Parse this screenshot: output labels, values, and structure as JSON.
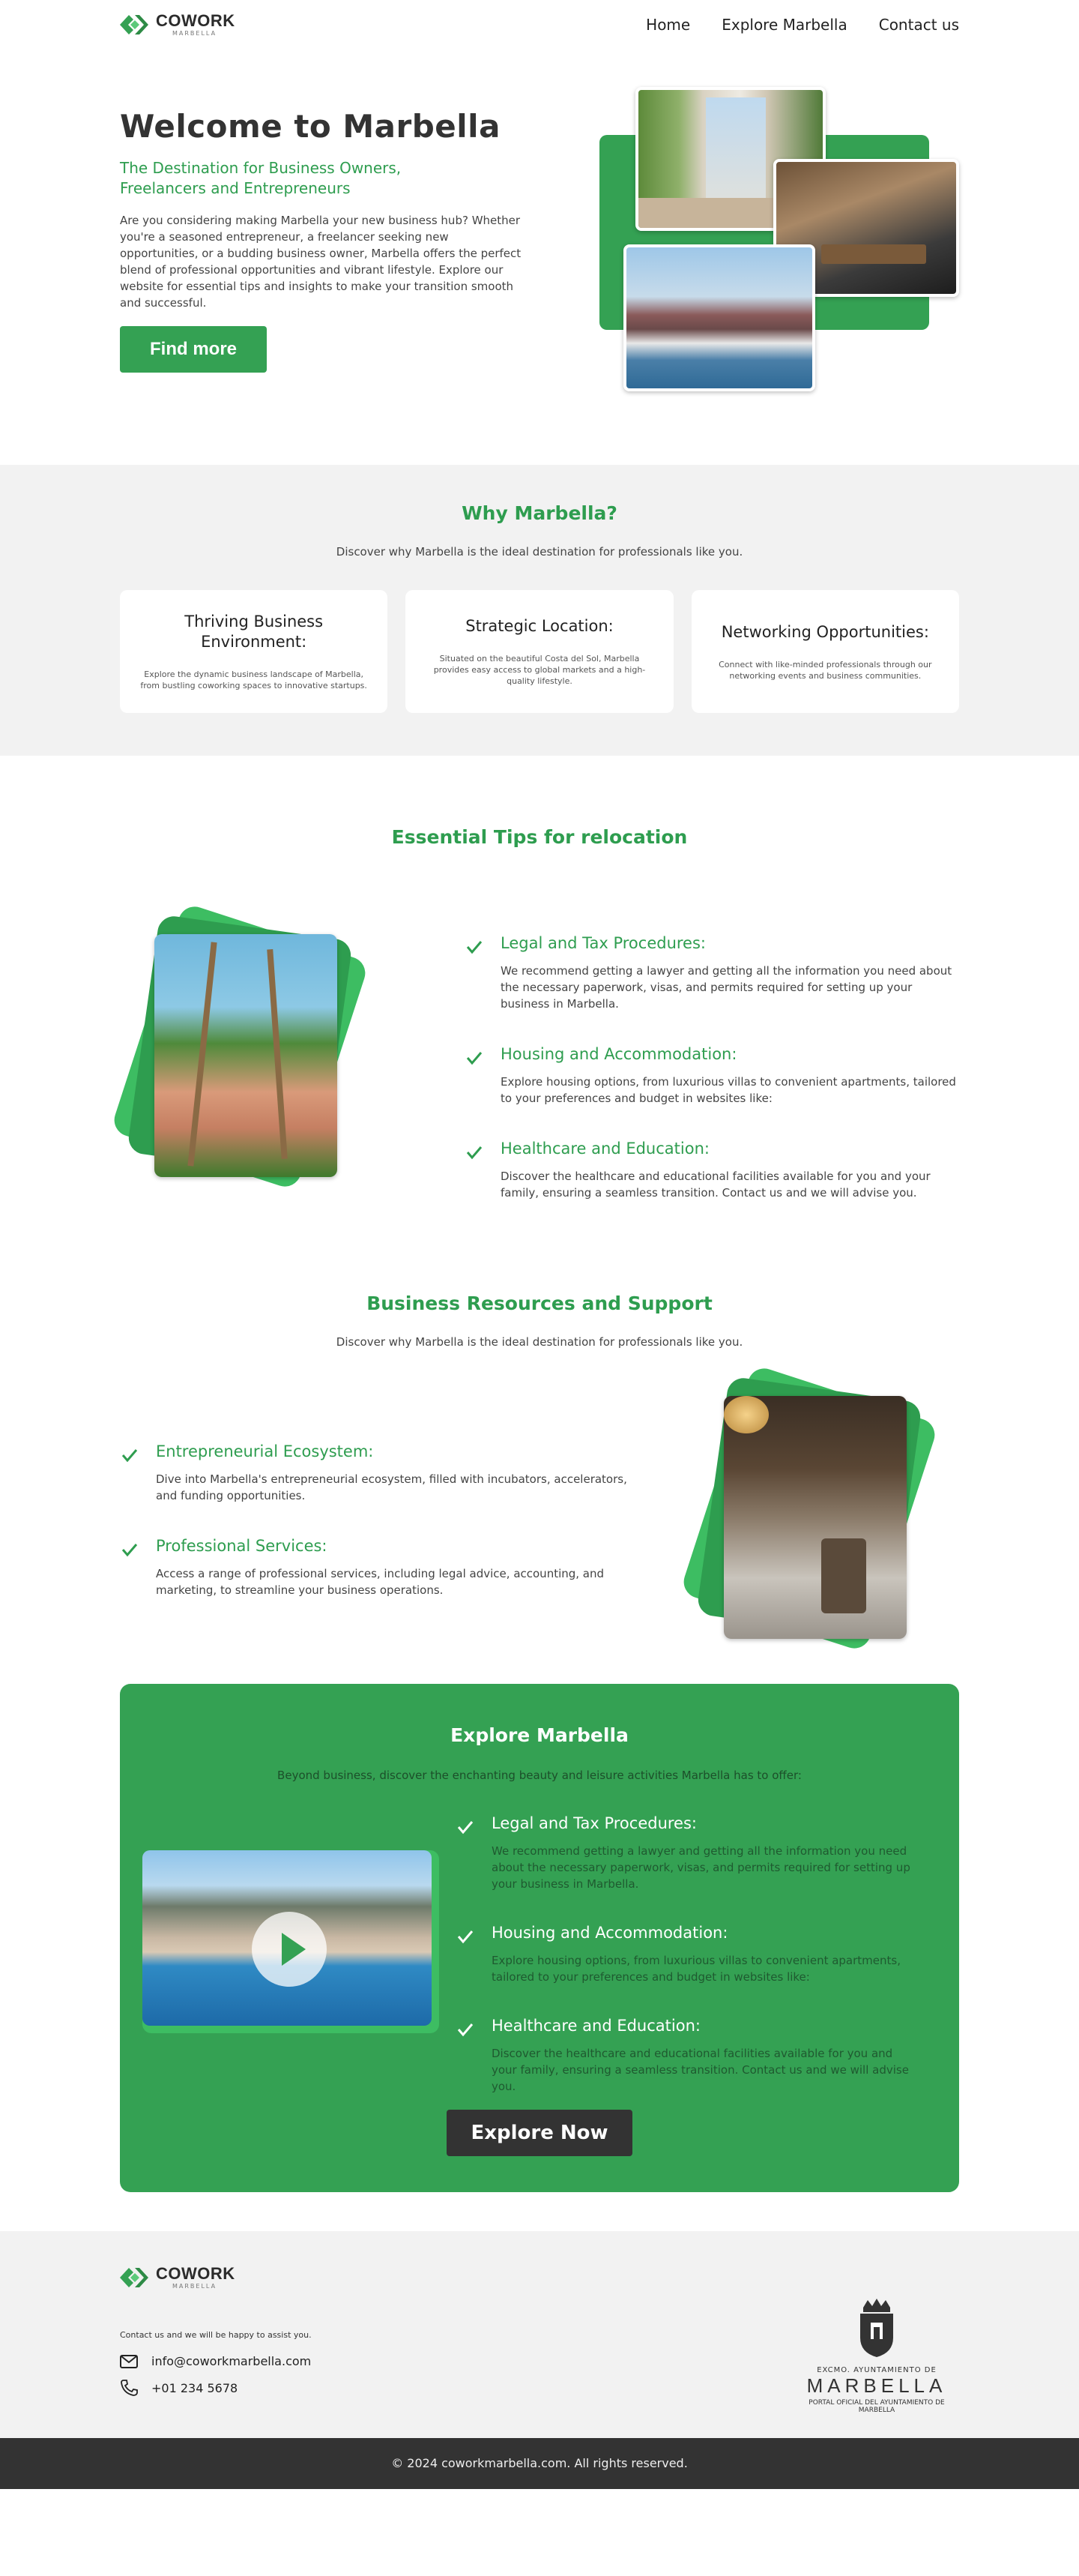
{
  "header": {
    "logo_main": "COWORK",
    "logo_sub": "MARBELLA",
    "nav": [
      "Home",
      "Explore Marbella",
      "Contact us"
    ]
  },
  "hero": {
    "title": "Welcome to Marbella",
    "subtitle": "The Destination for Business Owners, Freelancers and Entrepreneurs",
    "body": "Are you considering making Marbella your new business hub? Whether you're a seasoned entrepreneur, a freelancer seeking new opportunities, or a budding business owner, Marbella offers the perfect blend of professional opportunities and vibrant lifestyle. Explore our website for essential tips and insights to make your transition smooth and successful.",
    "button": "Find more"
  },
  "why": {
    "title": "Why Marbella?",
    "subtitle": "Discover why Marbella is the ideal destination for professionals like you.",
    "cards": [
      {
        "title": "Thriving Business Environment:",
        "text": "Explore the dynamic business landscape of Marbella, from bustling coworking spaces to innovative startups."
      },
      {
        "title": "Strategic Location:",
        "text": "Situated on the beautiful Costa del Sol, Marbella provides easy access to global markets and a high-quality lifestyle."
      },
      {
        "title": "Networking Opportunities:",
        "text": "Connect with like-minded professionals through our networking events and business communities."
      }
    ]
  },
  "tips": {
    "title": "Essential Tips for relocation",
    "items": [
      {
        "title": "Legal and Tax Procedures:",
        "text": "We recommend getting a lawyer and getting all the information you need about the necessary paperwork, visas, and permits required for setting up your business in Marbella."
      },
      {
        "title": "Housing and Accommodation:",
        "text": "Explore housing options, from luxurious villas to convenient apartments, tailored to your preferences and budget in websites like:"
      },
      {
        "title": "Healthcare and Education:",
        "text": "Discover the healthcare and educational facilities available for you and your family, ensuring a seamless transition. Contact us and we will advise you."
      }
    ]
  },
  "resources": {
    "title": "Business Resources and Support",
    "subtitle": "Discover why Marbella is the ideal destination for professionals like you.",
    "items": [
      {
        "title": "Entrepreneurial Ecosystem:",
        "text": "Dive into Marbella's entrepreneurial ecosystem, filled with incubators, accelerators, and funding opportunities."
      },
      {
        "title": "Professional Services:",
        "text": "Access a range of professional services, including legal advice, accounting, and marketing, to streamline your business operations."
      }
    ]
  },
  "explore": {
    "title": "Explore Marbella",
    "subtitle": "Beyond business, discover the enchanting beauty and leisure activities Marbella has to offer:",
    "items": [
      {
        "title": "Legal and Tax Procedures:",
        "text": "We recommend getting a lawyer and getting all the information you need about the necessary paperwork, visas, and permits required for setting up your business in Marbella."
      },
      {
        "title": "Housing and Accommodation:",
        "text": "Explore housing options, from luxurious villas to convenient apartments, tailored to your preferences and budget in websites like:"
      },
      {
        "title": "Healthcare and Education:",
        "text": "Discover the healthcare and educational facilities available for you and your family, ensuring a seamless transition. Contact us and we will advise you."
      }
    ],
    "button": "Explore Now"
  },
  "footer": {
    "logo_main": "COWORK",
    "logo_sub": "MARBELLA",
    "contact_text": "Contact us and we will be happy to assist you.",
    "email": "info@coworkmarbella.com",
    "phone": "+01 234 5678",
    "city_line1": "EXCMO. AYUNTAMIENTO DE",
    "city_line2": "MARBELLA",
    "city_line3": "PORTAL OFICIAL DEL AYUNTAMIENTO DE MARBELLA",
    "copyright": "© 2024 coworkmarbella.com. All rights reserved."
  },
  "colors": {
    "accent": "#34a153",
    "dark": "#333333",
    "light_bg": "#f2f2f2"
  }
}
